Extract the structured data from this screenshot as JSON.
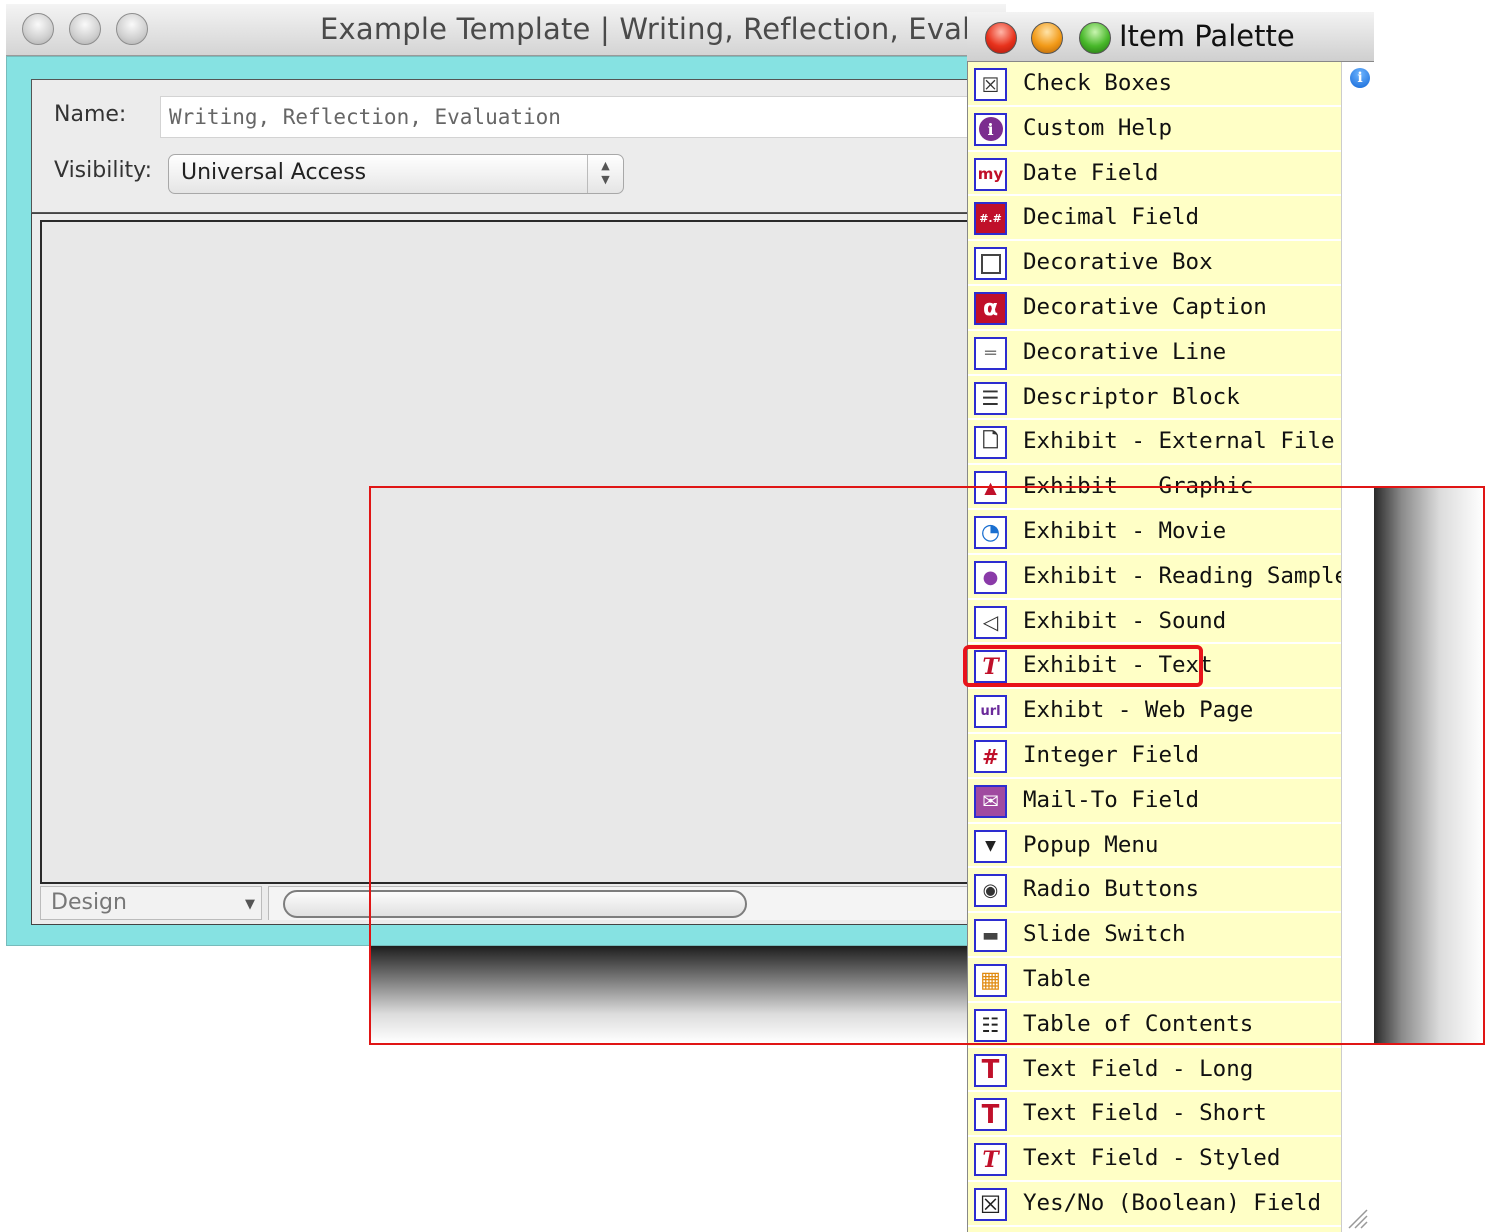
{
  "main_window": {
    "title": "Example Template | Writing, Reflection, Evalua",
    "name_label": "Name:",
    "name_value": "Writing, Reflection, Evaluation",
    "visibility_label": "Visibility:",
    "visibility_value": "Universal Access",
    "design_mode": "Design"
  },
  "palette": {
    "title": "Item Palette",
    "info_icon": "i",
    "items": [
      {
        "label": "Check Boxes",
        "icon": "checkboxes-icon"
      },
      {
        "label": "Custom Help",
        "icon": "info-circle-icon"
      },
      {
        "label": "Date Field",
        "icon": "calendar-my-icon"
      },
      {
        "label": "Decimal Field",
        "icon": "decimal-icon"
      },
      {
        "label": "Decorative Box",
        "icon": "box-icon"
      },
      {
        "label": "Decorative Caption",
        "icon": "caption-a-icon"
      },
      {
        "label": "Decorative Line",
        "icon": "line-icon"
      },
      {
        "label": "Descriptor Block",
        "icon": "descriptor-icon"
      },
      {
        "label": "Exhibit - External File",
        "icon": "file-icon"
      },
      {
        "label": "Exhibit - Graphic",
        "icon": "graphic-icon"
      },
      {
        "label": "Exhibit - Movie",
        "icon": "movie-icon"
      },
      {
        "label": "Exhibit - Reading Sample",
        "icon": "microphone-icon"
      },
      {
        "label": "Exhibit - Sound",
        "icon": "speaker-icon"
      },
      {
        "label": "Exhibit - Text",
        "icon": "styled-t-icon"
      },
      {
        "label": "Exhibt - Web Page",
        "icon": "url-icon"
      },
      {
        "label": "Integer Field",
        "icon": "hash-icon"
      },
      {
        "label": "Mail-To Field",
        "icon": "envelope-icon"
      },
      {
        "label": "Popup Menu",
        "icon": "popup-icon"
      },
      {
        "label": "Radio Buttons",
        "icon": "radio-icon"
      },
      {
        "label": "Slide Switch",
        "icon": "switch-icon"
      },
      {
        "label": "Table",
        "icon": "table-icon"
      },
      {
        "label": "Table of Contents",
        "icon": "toc-icon"
      },
      {
        "label": "Text Field - Long",
        "icon": "text-long-icon"
      },
      {
        "label": "Text Field - Short",
        "icon": "text-short-icon"
      },
      {
        "label": "Text Field - Styled",
        "icon": "styled-t-icon"
      },
      {
        "label": "Yes/No (Boolean) Field",
        "icon": "boolean-x-icon"
      }
    ]
  },
  "colors": {
    "palette_bg": "#ffffc6",
    "window_frame": "#86e2e2",
    "highlight": "#e8131a",
    "icon_border": "#2d2dd0"
  }
}
